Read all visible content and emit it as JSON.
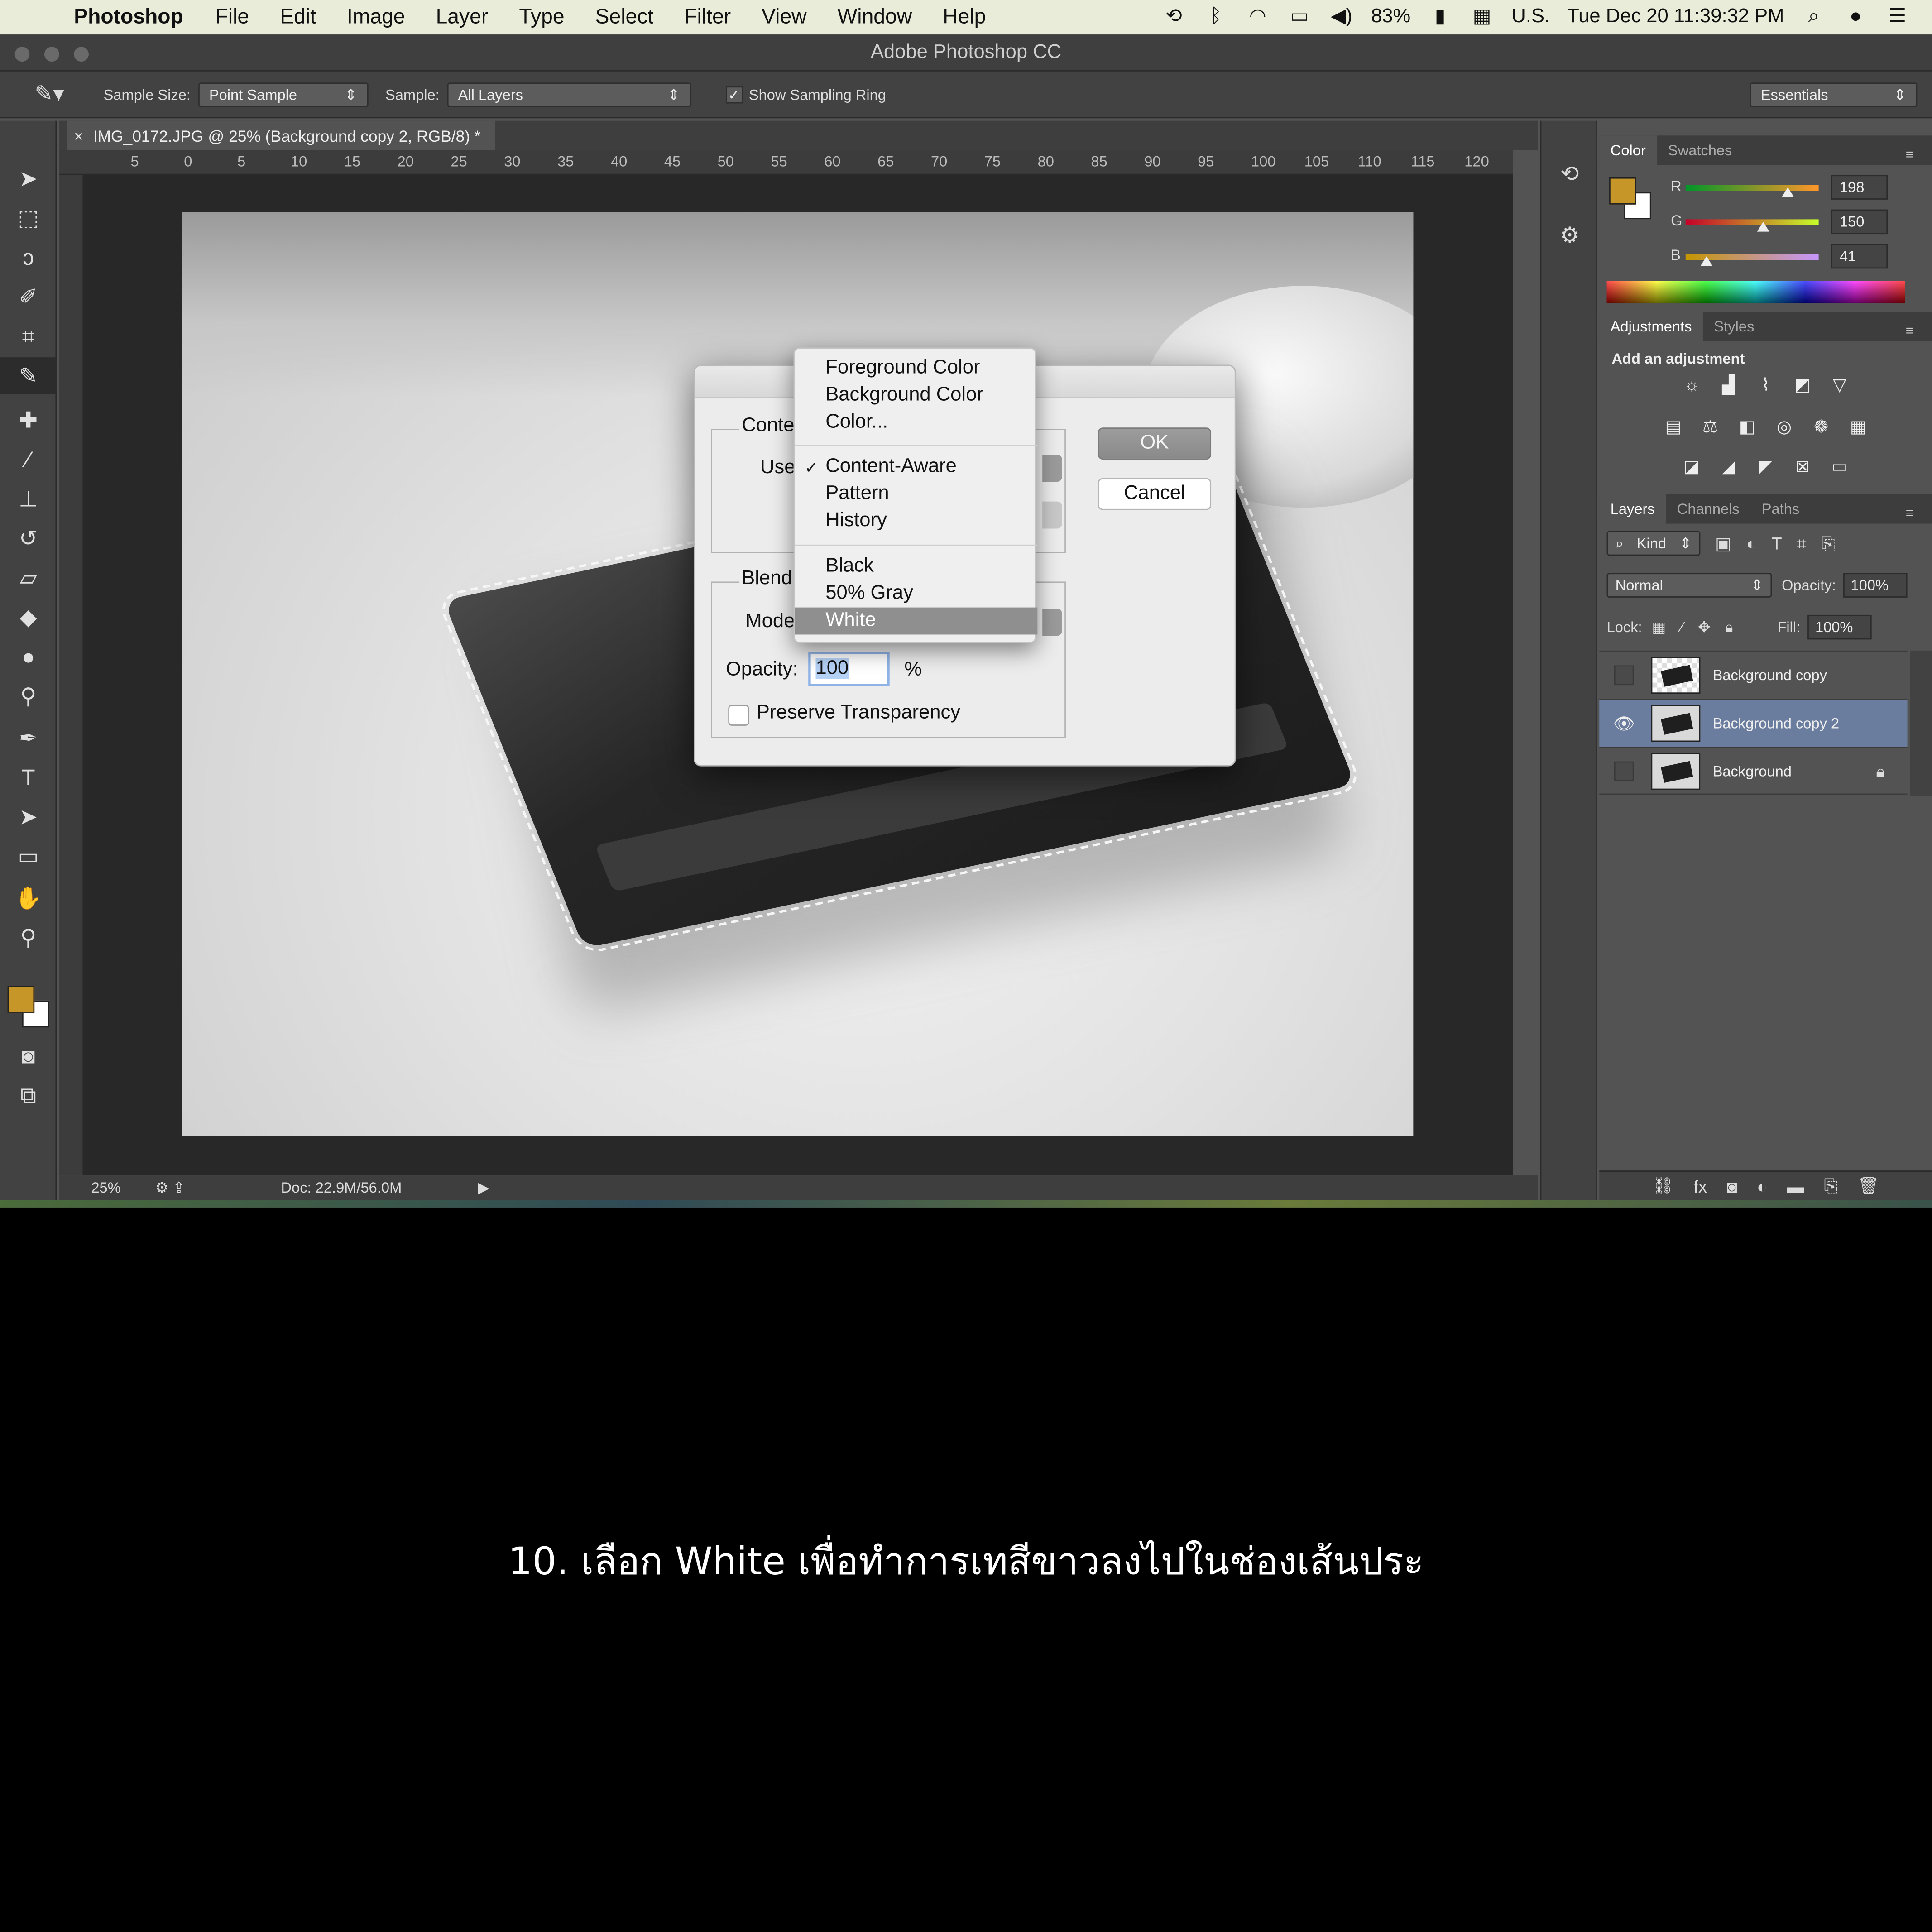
{
  "menubar": {
    "app_name": "Photoshop",
    "items": [
      "File",
      "Edit",
      "Image",
      "Layer",
      "Type",
      "Select",
      "Filter",
      "View",
      "Window",
      "Help"
    ],
    "battery": "83%",
    "input_source": "U.S.",
    "clock": "Tue Dec 20  11:39:32 PM"
  },
  "window": {
    "title": "Adobe Photoshop CC"
  },
  "options_bar": {
    "sample_size_label": "Sample Size:",
    "sample_size_value": "Point Sample",
    "sample_label": "Sample:",
    "sample_value": "All Layers",
    "show_ring_label": "Show Sampling Ring",
    "workspace_value": "Essentials"
  },
  "document": {
    "tab_title": "IMG_0172.JPG @ 25% (Background copy 2, RGB/8) *",
    "ruler_ticks": [
      "5",
      "0",
      "5",
      "10",
      "15",
      "20",
      "25",
      "30",
      "35",
      "40",
      "45",
      "50",
      "55",
      "60",
      "65",
      "70",
      "75",
      "80",
      "85",
      "90",
      "95",
      "100",
      "105",
      "110",
      "115",
      "120"
    ],
    "zoom": "25%",
    "doc_size": "Doc: 22.9M/56.0M"
  },
  "color_panel": {
    "tabs": [
      "Color",
      "Swatches"
    ],
    "r_label": "R",
    "g_label": "G",
    "b_label": "B",
    "r": "198",
    "g": "150",
    "b": "41",
    "foreground_color": "#c69629",
    "background_color": "#ffffff"
  },
  "adjustments_panel": {
    "tabs": [
      "Adjustments",
      "Styles"
    ],
    "add_label": "Add an adjustment"
  },
  "layers_panel": {
    "tabs": [
      "Layers",
      "Channels",
      "Paths"
    ],
    "filter_kind": "Kind",
    "blend_mode": "Normal",
    "opacity_label": "Opacity:",
    "opacity_value": "100%",
    "lock_label": "Lock:",
    "fill_label": "Fill:",
    "fill_value": "100%",
    "layers": [
      {
        "name": "Background copy"
      },
      {
        "name": "Background copy 2"
      },
      {
        "name": "Background"
      }
    ]
  },
  "fill_dialog": {
    "contents_label": "Conte",
    "use_label": "Use",
    "blending_label": "Blendi",
    "mode_label": "Mode",
    "opacity_label": "Opacity:",
    "opacity_value": "100",
    "percent": "%",
    "preserve_label": "Preserve Transparency",
    "ok_label": "OK",
    "cancel_label": "Cancel"
  },
  "use_menu": {
    "items": [
      "Foreground Color",
      "Background Color",
      "Color...",
      "Content-Aware",
      "Pattern",
      "History",
      "Black",
      "50% Gray",
      "White"
    ],
    "checked": "Content-Aware",
    "highlighted": "White"
  },
  "caption": "10. เลือก White เพื่อทำการเทสีขาวลงไปในช่องเส้นประ"
}
